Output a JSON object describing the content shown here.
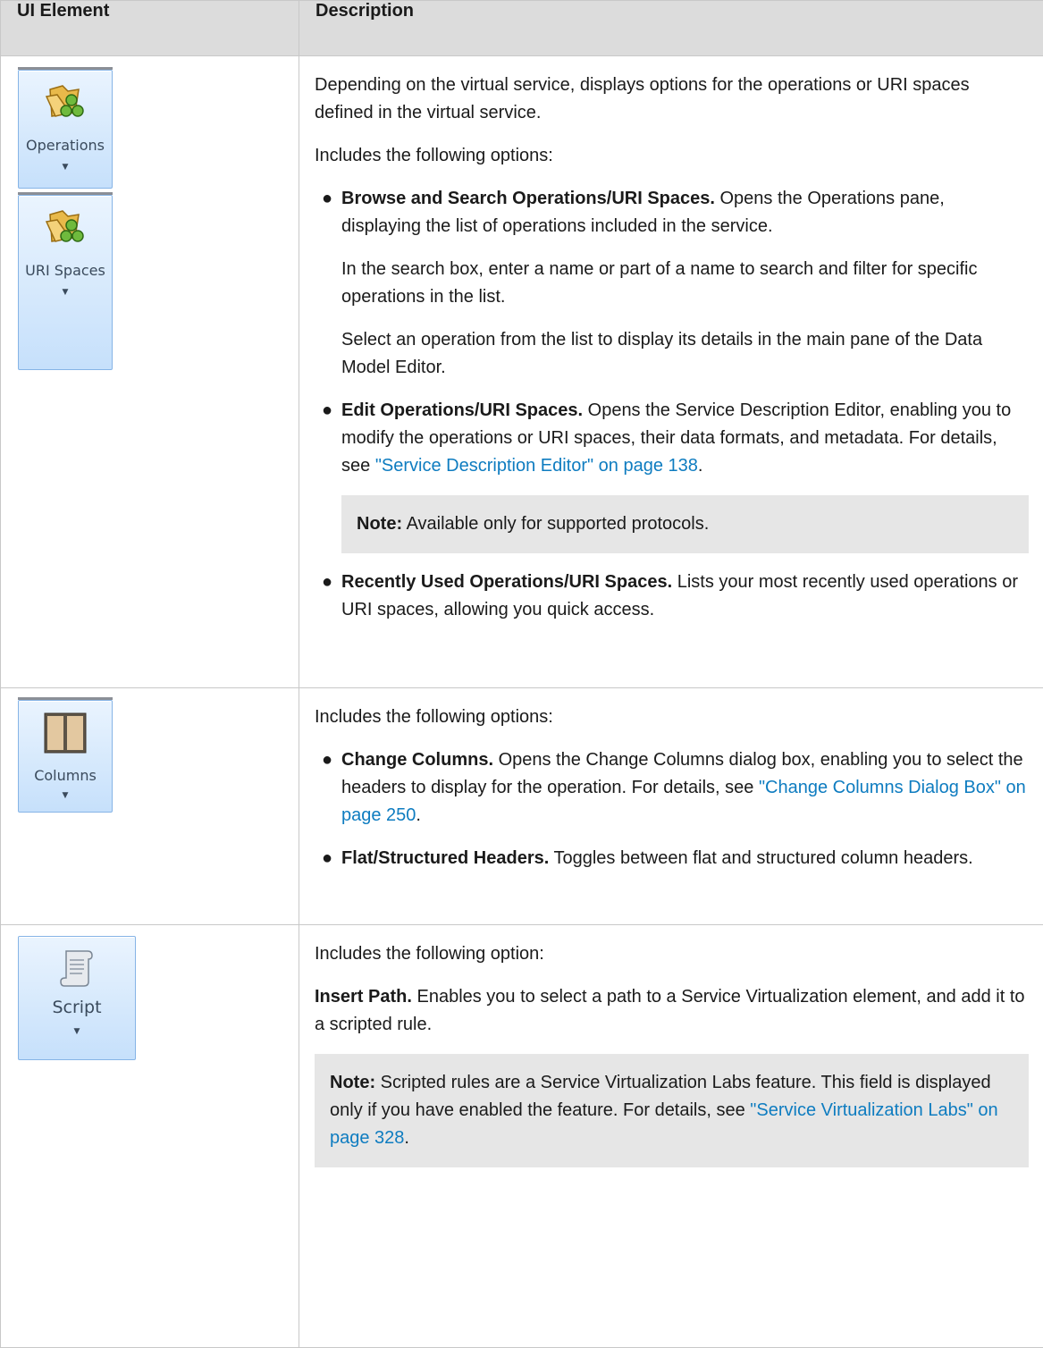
{
  "table": {
    "col_element": "UI Element",
    "col_description": "Description"
  },
  "row1": {
    "buttons": [
      {
        "label": "Operations",
        "icon": "operations-folder-icon"
      },
      {
        "label": "URI Spaces",
        "icon": "uri-spaces-folder-icon"
      }
    ],
    "intro": "Depending on the virtual service, displays options for the operations or URI spaces defined in the virtual service.",
    "includes": "Includes the following options:",
    "opt1_title": "Browse and Search Operations/URI Spaces.",
    "opt1_text": " Opens the Operations pane, displaying the list of operations included in the service.",
    "opt1_p2": "In the search box, enter a name or part of a name to search and filter for specific operations in the list.",
    "opt1_p3": "Select an operation from the list to display its details in the main pane of the Data Model Editor.",
    "opt2_title": "Edit Operations/URI Spaces.",
    "opt2_text": " Opens the Service Description Editor, enabling you to modify the operations or URI spaces, their data formats, and metadata. For details, see ",
    "opt2_link": "\"Service Description Editor\" on page 138",
    "opt2_end": ".",
    "note_label": "Note:",
    "note_text": " Available only for supported protocols.",
    "opt3_title": "Recently Used Operations/URI Spaces.",
    "opt3_text": " Lists your most recently used operations or URI spaces, allowing you quick access."
  },
  "row2": {
    "button": {
      "label": "Columns",
      "icon": "columns-icon"
    },
    "includes": "Includes the following options:",
    "opt1_title": "Change Columns.",
    "opt1_text": " Opens the Change Columns dialog box, enabling you to select the headers to display for the operation. For details, see ",
    "opt1_link": "\"Change Columns Dialog Box\" on page 250",
    "opt1_end": ".",
    "opt2_title": "Flat/Structured Headers.",
    "opt2_text": " Toggles between flat and structured column headers."
  },
  "row3": {
    "button": {
      "label": "Script",
      "icon": "script-scroll-icon"
    },
    "includes": "Includes the following option:",
    "p_title": "Insert Path.",
    "p_text": " Enables you to select a path to a Service Virtualization element, and add it to a scripted rule.",
    "note_label": "Note:",
    "note_text": " Scripted rules are a Service Virtualization Labs feature. This field is displayed only if you have enabled the feature. For details, see ",
    "note_link": "\"Service Virtualization Labs\" on page 328",
    "note_end": "."
  },
  "colors": {
    "header_bg": "#dcdcdc",
    "link": "#0e7cc0",
    "note_bg": "#e6e6e6",
    "button_border": "#86b4e6"
  }
}
